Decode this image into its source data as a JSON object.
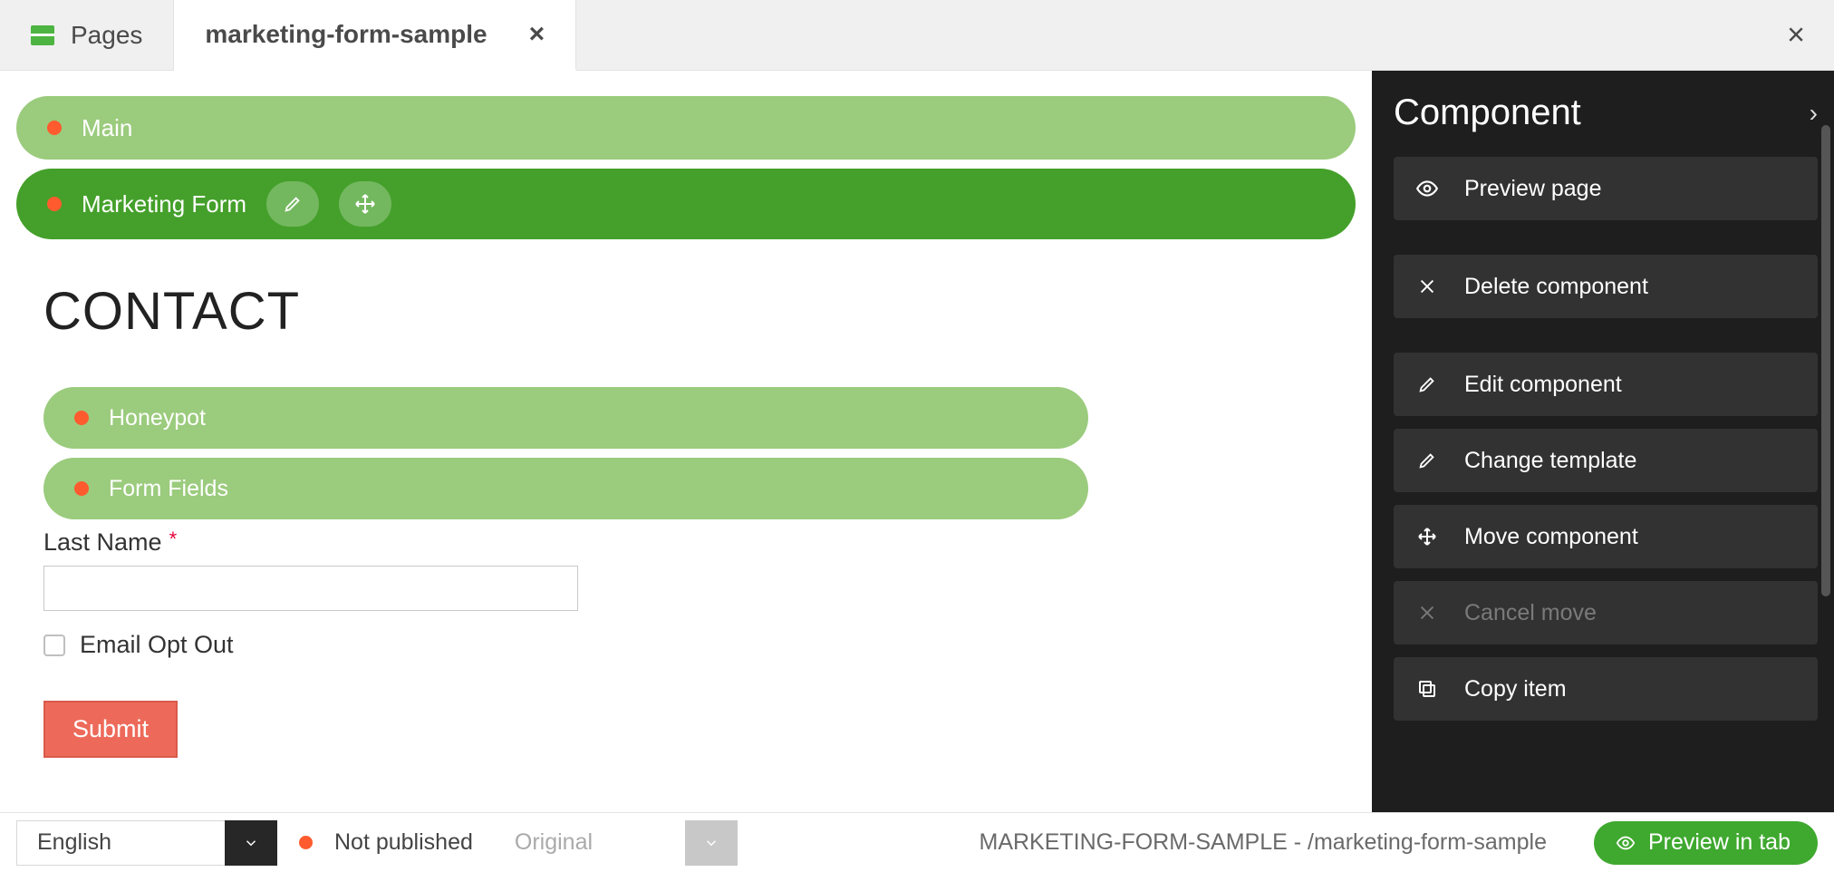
{
  "tabs": {
    "pages_label": "Pages",
    "active_label": "marketing-form-sample"
  },
  "canvas": {
    "main_label": "Main",
    "selected_label": "Marketing Form",
    "heading": "CONTACT",
    "sub1": "Honeypot",
    "sub2": "Form Fields",
    "lastname_label": "Last Name",
    "required_mark": "*",
    "optout_label": "Email Opt Out",
    "submit_label": "Submit"
  },
  "panel": {
    "title": "Component",
    "items": {
      "preview": "Preview page",
      "delete": "Delete component",
      "edit": "Edit component",
      "changetpl": "Change template",
      "move": "Move component",
      "cancelmove": "Cancel move",
      "copy": "Copy item"
    }
  },
  "status": {
    "language": "English",
    "pubstate": "Not published",
    "original": "Original",
    "path_upper": "MARKETING-FORM-SAMPLE",
    "path_sep": " - ",
    "path_slug": "/marketing-form-sample",
    "preview_btn": "Preview in tab"
  }
}
